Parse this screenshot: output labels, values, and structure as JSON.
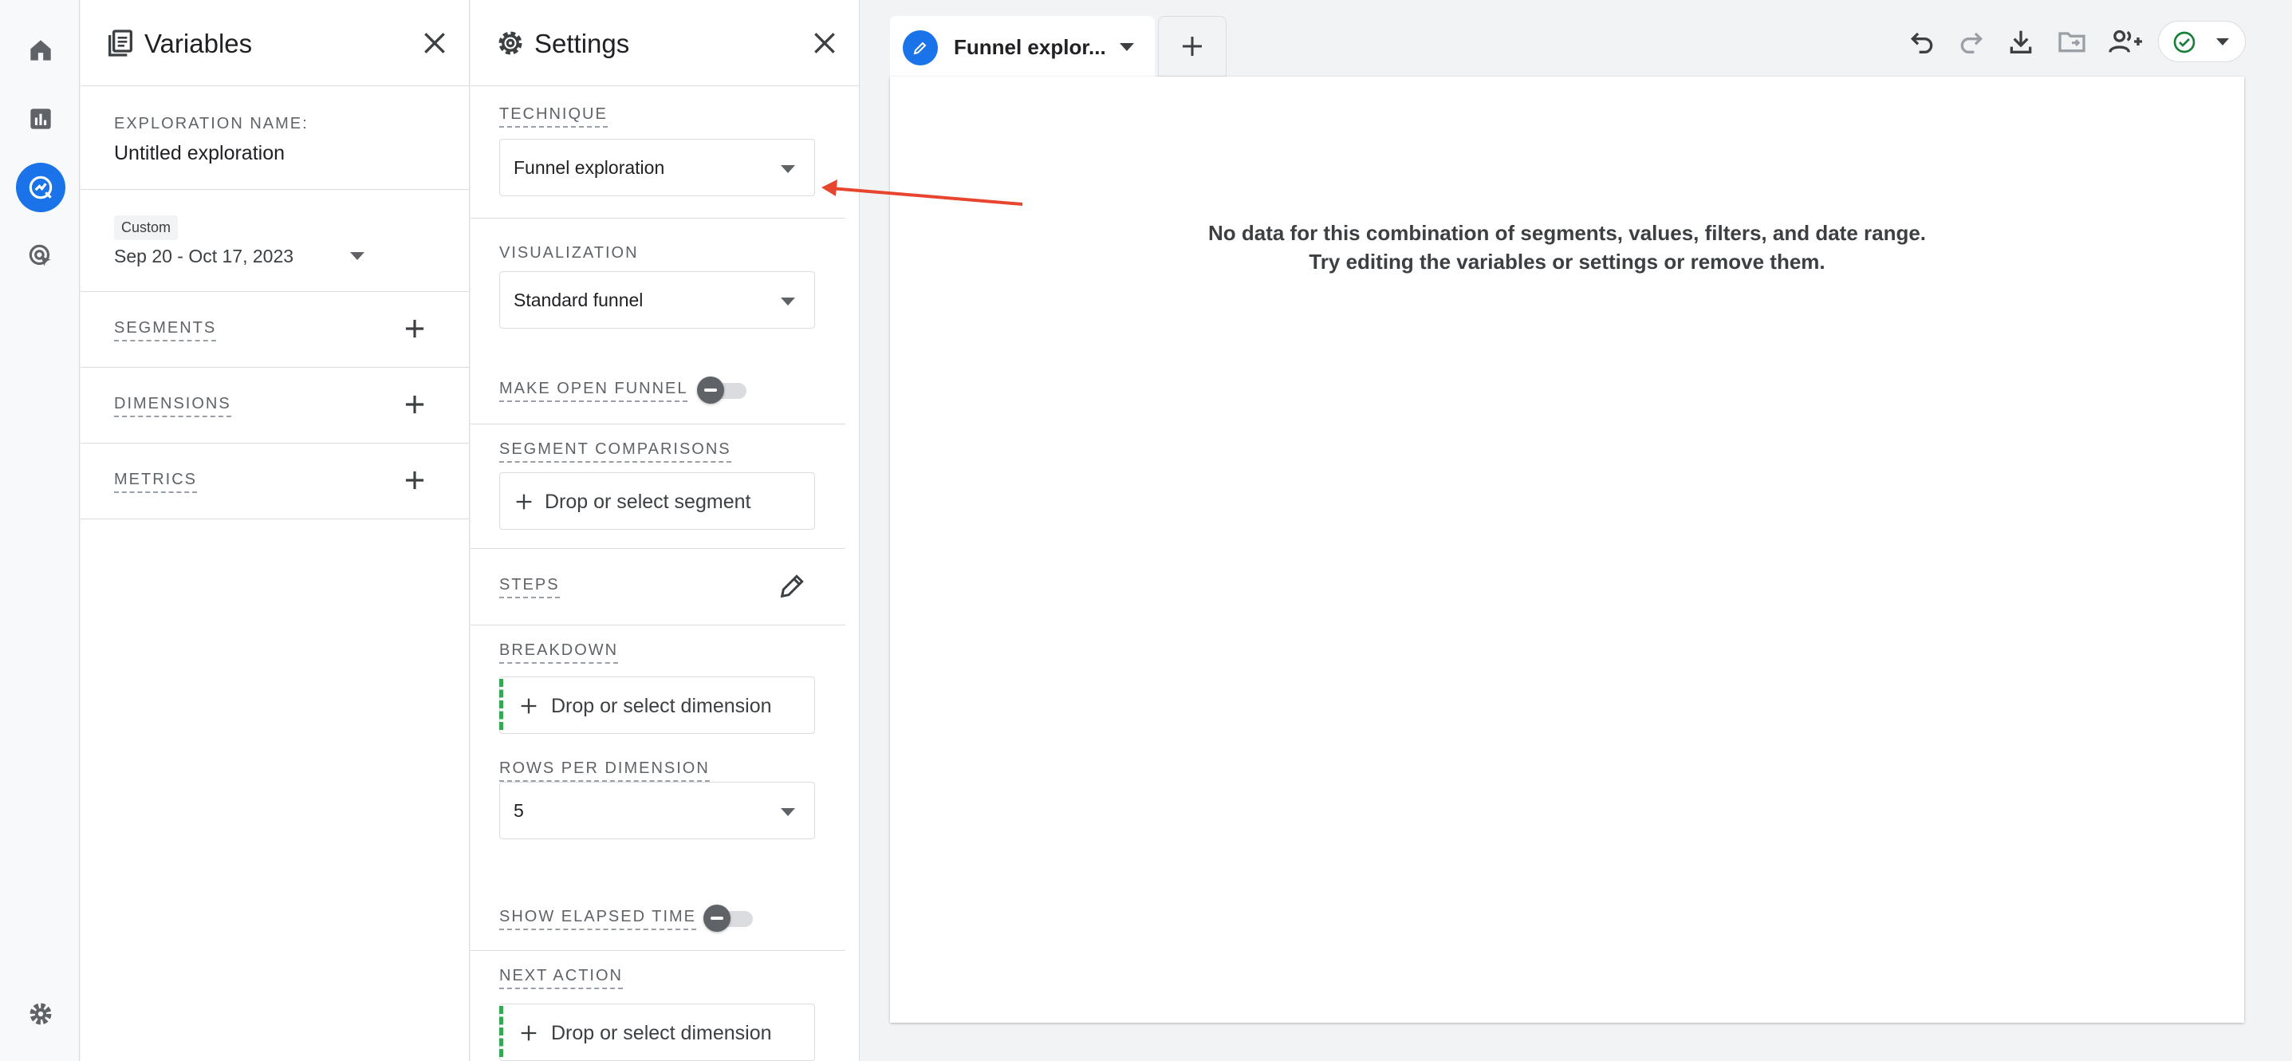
{
  "variables_panel": {
    "title": "Variables",
    "exploration_name_label": "EXPLORATION NAME:",
    "exploration_name": "Untitled exploration",
    "date_chip": "Custom",
    "date_range": "Sep 20 - Oct 17, 2023",
    "segments_label": "SEGMENTS",
    "dimensions_label": "DIMENSIONS",
    "metrics_label": "METRICS"
  },
  "settings_panel": {
    "title": "Settings",
    "technique_label": "TECHNIQUE",
    "technique_value": "Funnel exploration",
    "visualization_label": "VISUALIZATION",
    "visualization_value": "Standard funnel",
    "open_funnel_label": "MAKE OPEN FUNNEL",
    "segment_comparisons_label": "SEGMENT COMPARISONS",
    "segment_drop_text": "Drop or select segment",
    "steps_label": "STEPS",
    "breakdown_label": "BREAKDOWN",
    "breakdown_drop_text": "Drop or select dimension",
    "rows_per_dimension_label": "ROWS PER DIMENSION",
    "rows_per_dimension_value": "5",
    "show_elapsed_label": "SHOW ELAPSED TIME",
    "next_action_label": "NEXT ACTION",
    "next_action_drop_text": "Drop or select dimension"
  },
  "main": {
    "tab_label": "Funnel explor...",
    "empty_line1": "No data for this combination of segments, values, filters, and date range.",
    "empty_line2": "Try editing the variables or settings or remove them."
  },
  "colors": {
    "accent": "#1a73e8",
    "annotation_arrow": "#e8452f",
    "status_check": "#188038",
    "breakdown_indicator": "#34a853"
  },
  "icons": [
    "home-icon",
    "reports-icon",
    "explore-icon",
    "advertising-icon",
    "admin-gear-icon",
    "undo-icon",
    "redo-icon",
    "download-icon",
    "move-folder-icon",
    "share-users-icon",
    "check-circle-icon",
    "pencil-icon"
  ]
}
